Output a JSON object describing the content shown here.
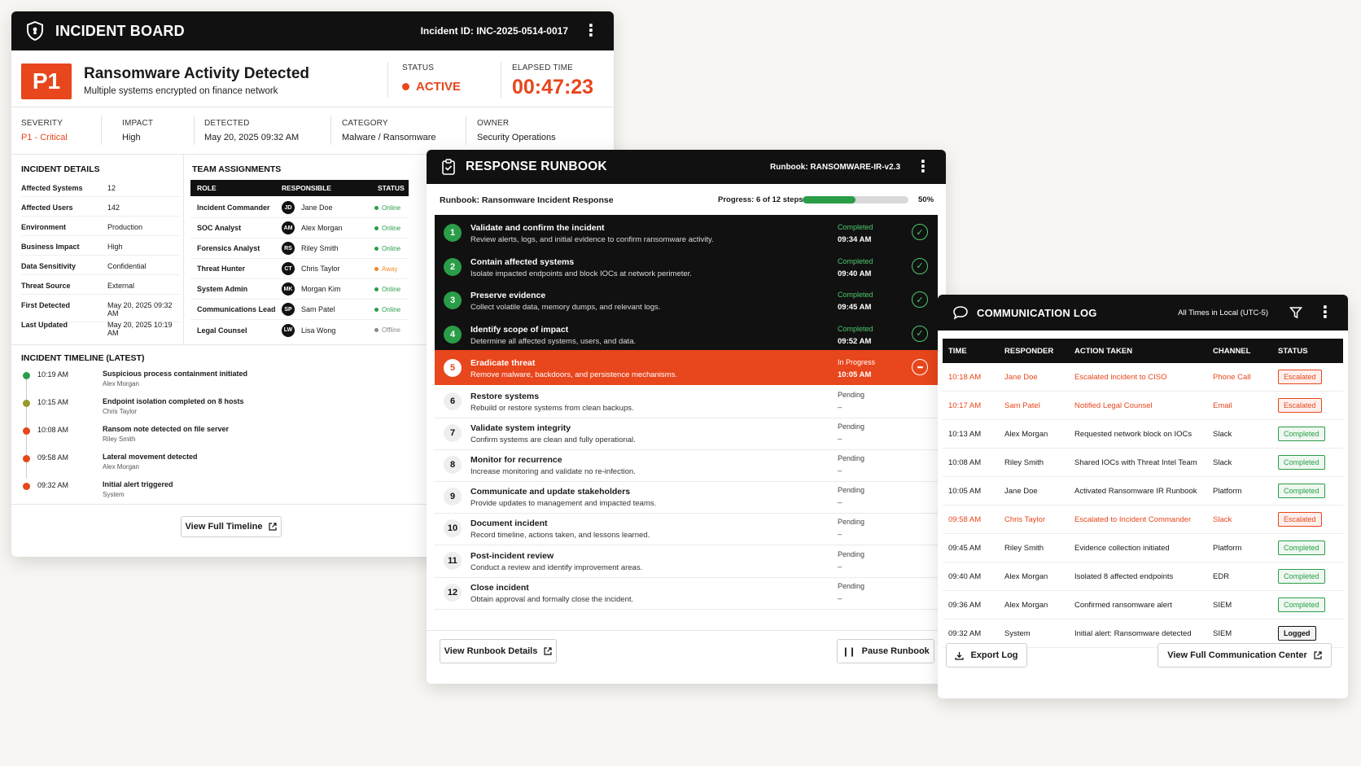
{
  "incident_board": {
    "title": "INCIDENT BOARD",
    "incident_id": "Incident ID: INC-2025-0514-0017",
    "priority": "P1",
    "incident_title": "Ransomware Activity Detected",
    "incident_subtitle": "Multiple systems encrypted on finance network",
    "status_caption": "STATUS",
    "status": "ACTIVE",
    "elapsed_caption": "ELAPSED TIME",
    "elapsed": "00:47:23",
    "meta": [
      {
        "label": "SEVERITY",
        "value": "P1 - Critical"
      },
      {
        "label": "IMPACT",
        "value": "High"
      },
      {
        "label": "DETECTED",
        "value": "May 20, 2025 09:32 AM"
      },
      {
        "label": "CATEGORY",
        "value": "Malware / Ransomware"
      },
      {
        "label": "OWNER",
        "value": "Security Operations"
      }
    ],
    "details_title": "INCIDENT DETAILS",
    "details": [
      {
        "k": "Affected Systems",
        "v": "12"
      },
      {
        "k": "Affected Users",
        "v": "142"
      },
      {
        "k": "Environment",
        "v": "Production"
      },
      {
        "k": "Business Impact",
        "v": "High"
      },
      {
        "k": "Data Sensitivity",
        "v": "Confidential"
      },
      {
        "k": "Threat Source",
        "v": "External"
      },
      {
        "k": "First Detected",
        "v": "May 20, 2025 09:32 AM"
      },
      {
        "k": "Last Updated",
        "v": "May 20, 2025 10:19 AM"
      }
    ],
    "team_title": "TEAM ASSIGNMENTS",
    "team_headers": [
      "ROLE",
      "RESPONSIBLE",
      "STATUS"
    ],
    "team": [
      {
        "role": "Incident Commander",
        "initials": "JD",
        "name": "Jane Doe",
        "status": "Online"
      },
      {
        "role": "SOC Analyst",
        "initials": "AM",
        "name": "Alex Morgan",
        "status": "Online"
      },
      {
        "role": "Forensics Analyst",
        "initials": "RS",
        "name": "Riley Smith",
        "status": "Online"
      },
      {
        "role": "Threat Hunter",
        "initials": "CT",
        "name": "Chris Taylor",
        "status": "Away"
      },
      {
        "role": "System Admin",
        "initials": "MK",
        "name": "Morgan Kim",
        "status": "Online"
      },
      {
        "role": "Communications Lead",
        "initials": "SP",
        "name": "Sam Patel",
        "status": "Online"
      },
      {
        "role": "Legal Counsel",
        "initials": "LW",
        "name": "Lisa Wong",
        "status": "Offline"
      }
    ],
    "timeline_title": "INCIDENT TIMELINE (LATEST)",
    "timeline": [
      {
        "time": "10:19 AM",
        "event": "Suspicious process containment initiated",
        "who": "Alex Morgan",
        "color": "#2a9d48"
      },
      {
        "time": "10:15 AM",
        "event": "Endpoint isolation completed on 8 hosts",
        "who": "Chris Taylor",
        "color": "#9a9a2a"
      },
      {
        "time": "10:08 AM",
        "event": "Ransom note detected on file server",
        "who": "Riley Smith",
        "color": "#e8461c"
      },
      {
        "time": "09:58 AM",
        "event": "Lateral movement detected",
        "who": "Alex Morgan",
        "color": "#e8461c"
      },
      {
        "time": "09:32 AM",
        "event": "Initial alert triggered",
        "who": "System",
        "color": "#e8461c"
      }
    ],
    "view_timeline": "View Full Timeline"
  },
  "runbook": {
    "title": "RESPONSE RUNBOOK",
    "runbook_id": "Runbook: RANSOMWARE-IR-v2.3",
    "name": "Runbook: Ransomware Incident Response",
    "progress_text": "Progress: 6 of 12 steps",
    "progress_fraction": 0.5,
    "progress_pct": "50%",
    "steps": [
      {
        "n": "1",
        "title": "Validate and confirm the incident",
        "desc": "Review alerts, logs, and initial evidence to confirm ransomware activity.",
        "status": "Completed",
        "time": "09:34 AM",
        "state": "done"
      },
      {
        "n": "2",
        "title": "Contain affected systems",
        "desc": "Isolate impacted endpoints and block IOCs at network perimeter.",
        "status": "Completed",
        "time": "09:40 AM",
        "state": "done"
      },
      {
        "n": "3",
        "title": "Preserve evidence",
        "desc": "Collect volatile data, memory dumps, and relevant logs.",
        "status": "Completed",
        "time": "09:45 AM",
        "state": "done"
      },
      {
        "n": "4",
        "title": "Identify scope of impact",
        "desc": "Determine all affected systems, users, and data.",
        "status": "Completed",
        "time": "09:52 AM",
        "state": "done"
      },
      {
        "n": "5",
        "title": "Eradicate threat",
        "desc": "Remove malware, backdoors, and persistence mechanisms.",
        "status": "In Progress",
        "time": "10:05 AM",
        "state": "active"
      },
      {
        "n": "6",
        "title": "Restore systems",
        "desc": "Rebuild or restore systems from clean backups.",
        "status": "Pending",
        "time": "–",
        "state": "pend"
      },
      {
        "n": "7",
        "title": "Validate system integrity",
        "desc": "Confirm systems are clean and fully operational.",
        "status": "Pending",
        "time": "–",
        "state": "pend"
      },
      {
        "n": "8",
        "title": "Monitor for recurrence",
        "desc": "Increase monitoring and validate no re-infection.",
        "status": "Pending",
        "time": "–",
        "state": "pend"
      },
      {
        "n": "9",
        "title": "Communicate and update stakeholders",
        "desc": "Provide updates to management and impacted teams.",
        "status": "Pending",
        "time": "–",
        "state": "pend"
      },
      {
        "n": "10",
        "title": "Document incident",
        "desc": "Record timeline, actions taken, and lessons learned.",
        "status": "Pending",
        "time": "–",
        "state": "pend"
      },
      {
        "n": "11",
        "title": "Post-incident review",
        "desc": "Conduct a review and identify improvement areas.",
        "status": "Pending",
        "time": "–",
        "state": "pend"
      },
      {
        "n": "12",
        "title": "Close incident",
        "desc": "Obtain approval and formally close the incident.",
        "status": "Pending",
        "time": "–",
        "state": "pend"
      }
    ],
    "view_details": "View Runbook Details",
    "pause": "Pause Runbook"
  },
  "comm_log": {
    "title": "COMMUNICATION LOG",
    "tz": "All Times in Local (UTC-5)",
    "headers": [
      "TIME",
      "RESPONDER",
      "ACTION TAKEN",
      "CHANNEL",
      "STATUS"
    ],
    "rows": [
      {
        "time": "10:18 AM",
        "who": "Jane Doe",
        "action": "Escalated incident to CISO",
        "channel": "Phone Call",
        "status": "Escalated",
        "kind": "esc"
      },
      {
        "time": "10:17 AM",
        "who": "Sam Patel",
        "action": "Notified Legal Counsel",
        "channel": "Email",
        "status": "Escalated",
        "kind": "esc"
      },
      {
        "time": "10:13 AM",
        "who": "Alex Morgan",
        "action": "Requested network block on IOCs",
        "channel": "Slack",
        "status": "Completed",
        "kind": "cmp"
      },
      {
        "time": "10:08 AM",
        "who": "Riley Smith",
        "action": "Shared IOCs with Threat Intel Team",
        "channel": "Slack",
        "status": "Completed",
        "kind": "cmp"
      },
      {
        "time": "10:05 AM",
        "who": "Jane Doe",
        "action": "Activated Ransomware IR Runbook",
        "channel": "Platform",
        "status": "Completed",
        "kind": "cmp"
      },
      {
        "time": "09:58 AM",
        "who": "Chris Taylor",
        "action": "Escalated to Incident Commander",
        "channel": "Slack",
        "status": "Escalated",
        "kind": "esc"
      },
      {
        "time": "09:45 AM",
        "who": "Riley Smith",
        "action": "Evidence collection initiated",
        "channel": "Platform",
        "status": "Completed",
        "kind": "cmp"
      },
      {
        "time": "09:40 AM",
        "who": "Alex Morgan",
        "action": "Isolated 8 affected endpoints",
        "channel": "EDR",
        "status": "Completed",
        "kind": "cmp"
      },
      {
        "time": "09:36 AM",
        "who": "Alex Morgan",
        "action": "Confirmed ransomware alert",
        "channel": "SIEM",
        "status": "Completed",
        "kind": "cmp"
      },
      {
        "time": "09:32 AM",
        "who": "System",
        "action": "Initial alert: Ransomware detected",
        "channel": "SIEM",
        "status": "Logged",
        "kind": "log"
      }
    ],
    "export": "Export Log",
    "view_center": "View Full Communication Center"
  },
  "colors": {
    "accent": "#e8461c",
    "success": "#2a9d48",
    "away": "#f08a24",
    "offline": "#888888",
    "header": "#111111"
  }
}
